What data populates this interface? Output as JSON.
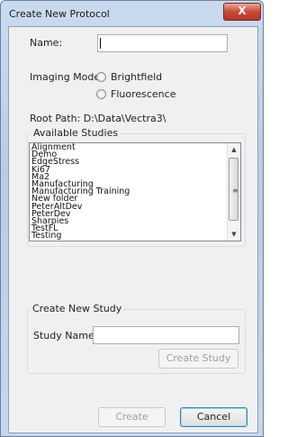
{
  "window": {
    "title": "Create New Protocol",
    "close_glyph": "X"
  },
  "name_field": {
    "label": "Name:",
    "value": ""
  },
  "imaging_mode": {
    "label": "Imaging Mode:",
    "options": [
      "Brightfield",
      "Fluorescence"
    ],
    "selected": null
  },
  "root_path": "Root Path: D:\\Data\\Vectra3\\",
  "available_studies": {
    "title": "Available Studies",
    "items": [
      "Alignment",
      "Demo",
      "EdgeStress",
      "Ki67",
      "Ma2",
      "Manufacturing",
      "Manufacturing Training",
      "New folder",
      "PeterAltDev",
      "PeterDev",
      "Sharpies",
      "TestFL",
      "Testing"
    ]
  },
  "create_new_study": {
    "title": "Create New Study",
    "study_name_label": "Study Name:",
    "study_name_value": "",
    "create_study_button": "Create Study"
  },
  "footer": {
    "create_button": "Create",
    "cancel_button": "Cancel"
  }
}
